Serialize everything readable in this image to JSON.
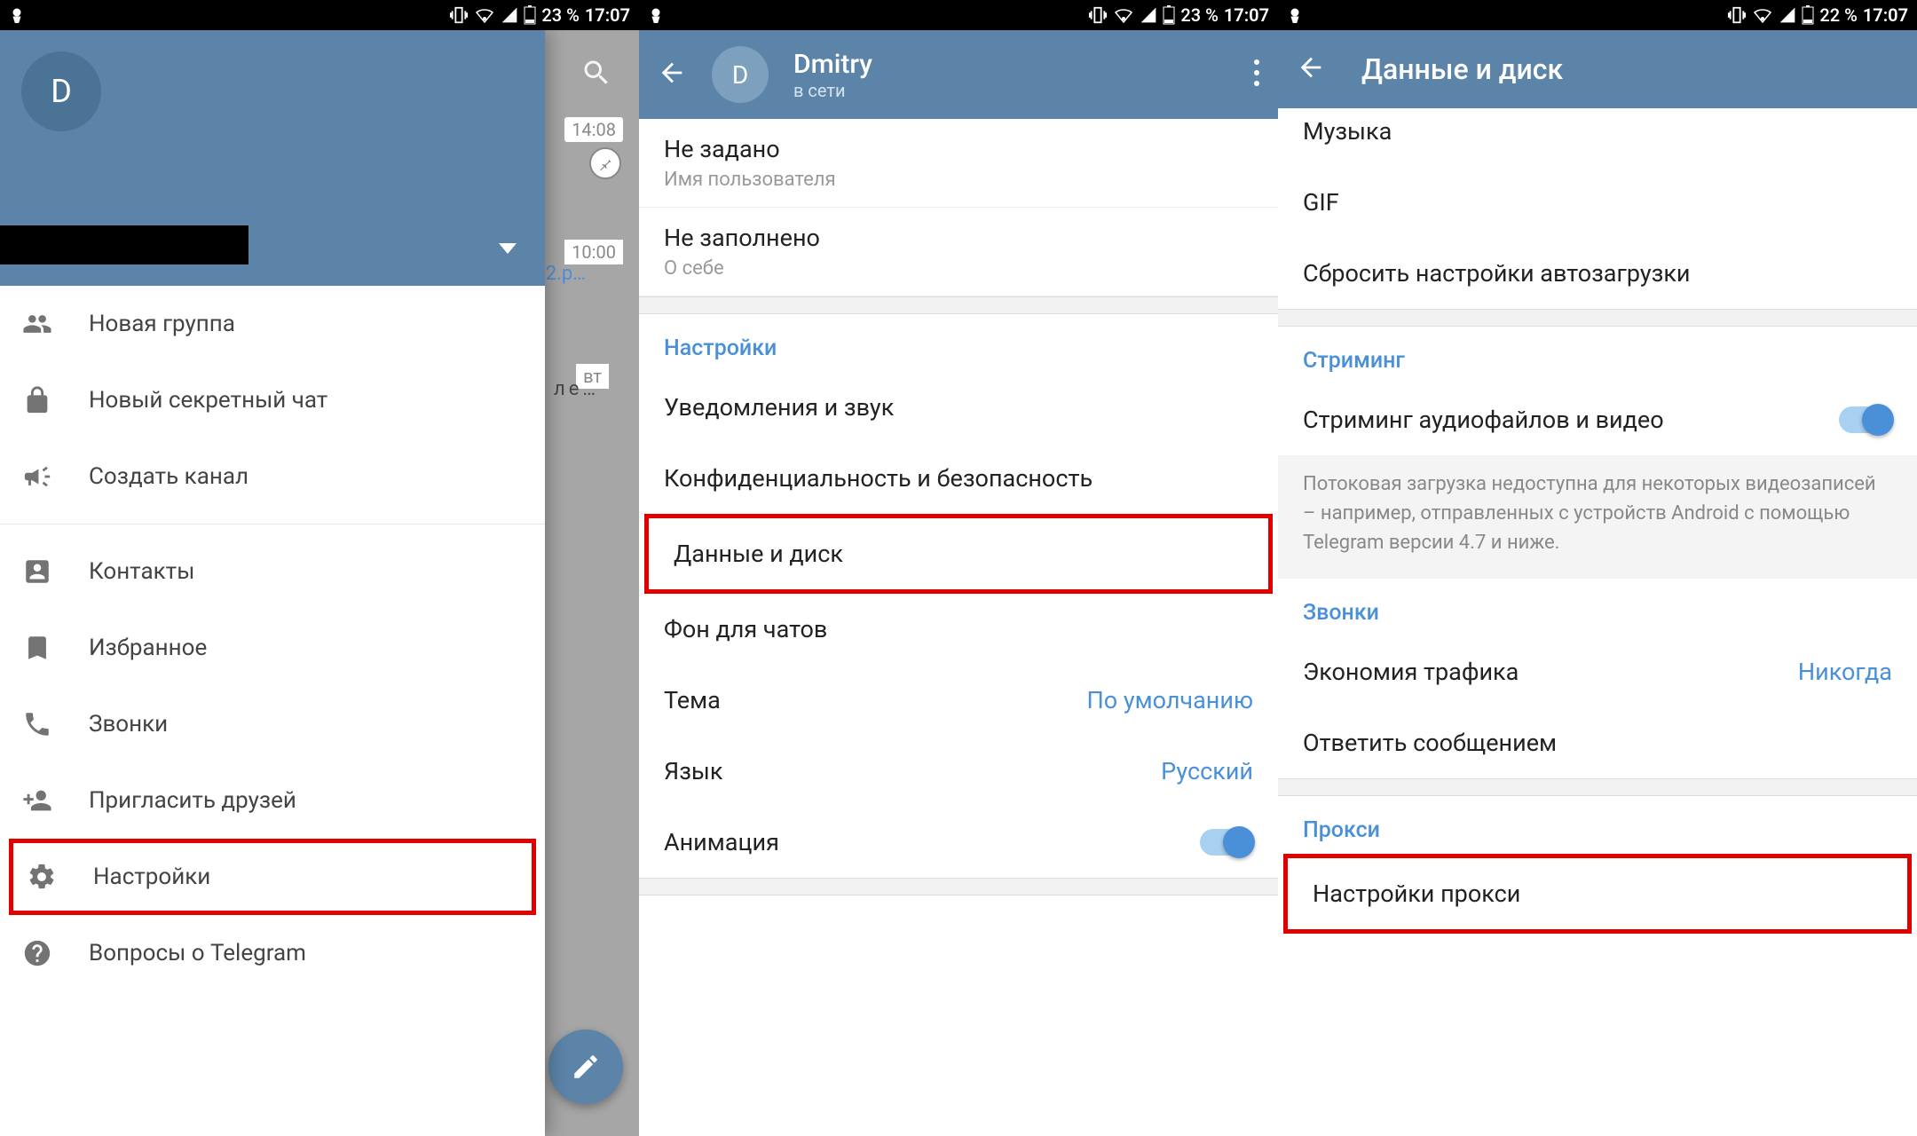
{
  "statusbar": {
    "battery1": "23 %",
    "battery2": "23 %",
    "battery3": "22 %",
    "time": "17:07"
  },
  "phone1": {
    "avatar_letter": "D",
    "peek": {
      "time1": "14:08",
      "time2": "10:00",
      "txt": "2.р…",
      "vt": "вт",
      "dots": "ле…"
    },
    "menu": {
      "new_group": "Новая группа",
      "new_secret_chat": "Новый секретный чат",
      "create_channel": "Создать канал",
      "contacts": "Контакты",
      "favorites": "Избранное",
      "calls": "Звонки",
      "invite": "Пригласить друзей",
      "settings": "Настройки",
      "faq": "Вопросы о Telegram"
    }
  },
  "phone2": {
    "profile_name": "Dmitry",
    "profile_status": "в сети",
    "avatar_letter": "D",
    "username_value": "Не задано",
    "username_label": "Имя пользователя",
    "bio_value": "Не заполнено",
    "bio_label": "О себе",
    "section_settings": "Настройки",
    "notifications": "Уведомления и звук",
    "privacy": "Конфиденциальность и безопасность",
    "data_storage": "Данные и диск",
    "chat_bg": "Фон для чатов",
    "theme": "Тема",
    "theme_value": "По умолчанию",
    "language": "Язык",
    "language_value": "Русский",
    "animation": "Анимация"
  },
  "phone3": {
    "title": "Данные и диск",
    "music": "Музыка",
    "gif": "GIF",
    "reset_autoload": "Сбросить настройки автозагрузки",
    "section_streaming": "Стриминг",
    "streaming_av": "Стриминг аудиофайлов и видео",
    "streaming_hint": "Потоковая загрузка недоступна для некоторых видеозаписей – например, отправленных с устройств Android с помощью Telegram версии 4.7 и ниже.",
    "section_calls": "Звонки",
    "data_saving": "Экономия трафика",
    "data_saving_value": "Никогда",
    "reply_msg": "Ответить сообщением",
    "section_proxy": "Прокси",
    "proxy_settings": "Настройки прокси"
  }
}
